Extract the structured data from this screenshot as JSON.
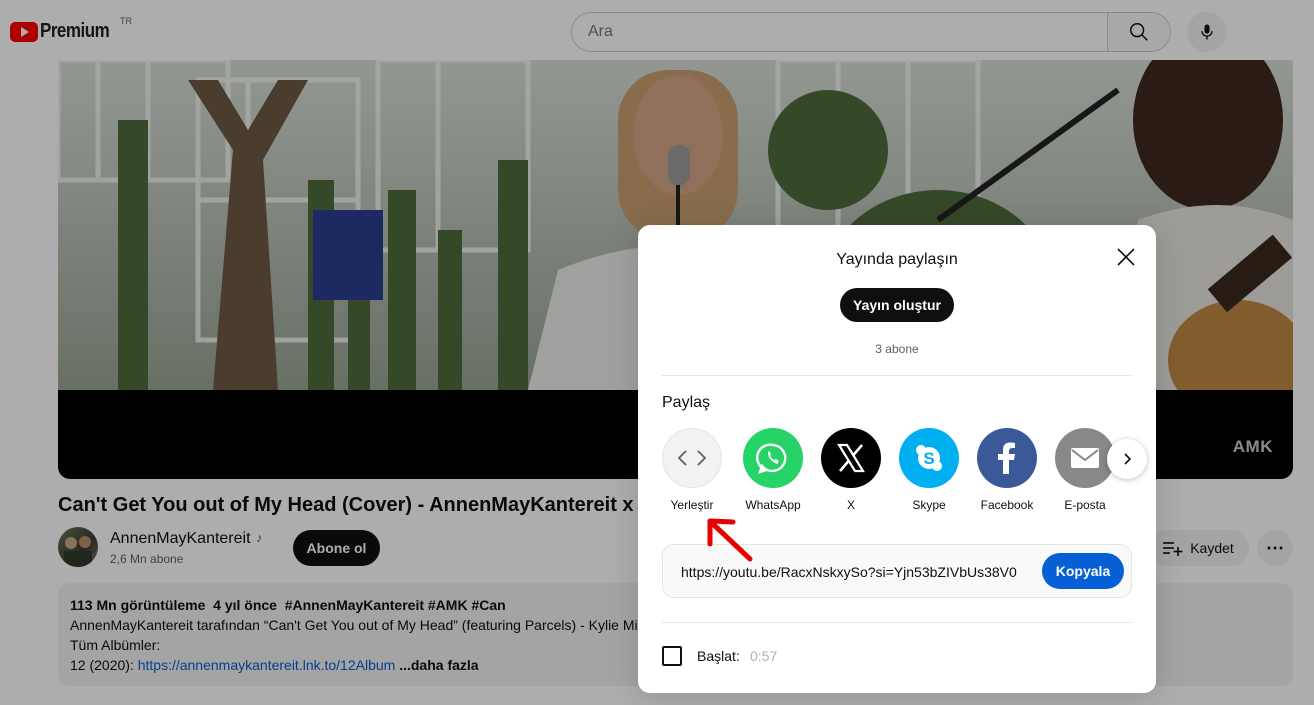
{
  "header": {
    "logo_text": "Premium",
    "country_code": "TR",
    "search_placeholder": "Ara"
  },
  "player": {
    "watermark": "AMK"
  },
  "video": {
    "title": "Can't Get You out of My Head (Cover) - AnnenMayKantereit x Par",
    "channel_name": "AnnenMayKantereit",
    "music_note": "♪",
    "subscribers": "2,6 Mn abone",
    "subscribe_label": "Abone ol",
    "save_label": "Kaydet",
    "more_label": "⋯"
  },
  "description": {
    "views": "113 Mn görüntüleme",
    "age": "4 yıl önce",
    "tags": "#AnnenMayKantereit #AMK #Can",
    "line1": "AnnenMayKantereit tarafından “Can't Get You out of My Head” (featuring Parcels) - Kylie Min",
    "line2": "Tüm Albümler:",
    "line3_prefix": "12 (2020): ",
    "line3_link": "https://annenmaykantereit.lnk.to/12Album",
    "more": "...daha fazla"
  },
  "share_dialog": {
    "title": "Yayında paylaşın",
    "create_post_label": "Yayın oluştur",
    "subscribers": "3 abone",
    "share_label": "Paylaş",
    "targets": [
      {
        "label": "Yerleştir",
        "icon": "embed-icon",
        "color": "#f2f2f2"
      },
      {
        "label": "WhatsApp",
        "icon": "whatsapp-icon",
        "color": "#25d366"
      },
      {
        "label": "X",
        "icon": "x-icon",
        "color": "#000000"
      },
      {
        "label": "Skype",
        "icon": "skype-icon",
        "color": "#00aff0"
      },
      {
        "label": "Facebook",
        "icon": "facebook-icon",
        "color": "#3b5998"
      },
      {
        "label": "E-posta",
        "icon": "email-icon",
        "color": "#888888"
      }
    ],
    "url": "https://youtu.be/RacxNskxySo?si=Yjn53bZIVbUs38V0",
    "copy_label": "Kopyala",
    "start_label": "Başlat:",
    "start_time": "0:57"
  },
  "colors": {
    "brand_red": "#ff0000",
    "copy_blue": "#065fd4",
    "annotation_red": "#e60000"
  }
}
